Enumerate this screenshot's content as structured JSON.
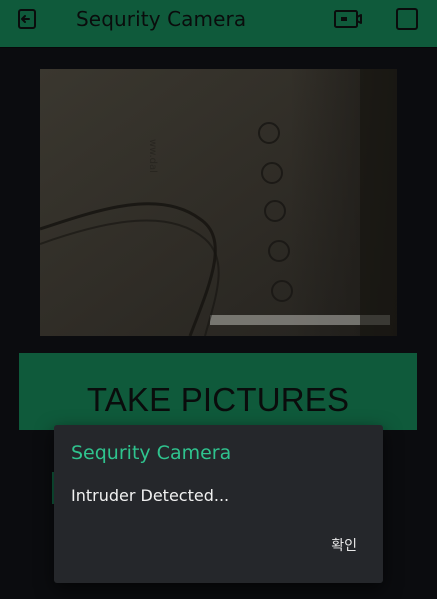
{
  "app_bar": {
    "title": "Sequrity Camera",
    "color": "#0f5a3b",
    "icons": {
      "left": "exit-icon",
      "right_primary": "camera-switch-icon",
      "right_secondary": "stop-icon"
    }
  },
  "preview": {
    "icon": "camera-preview-image"
  },
  "actions": {
    "take_pictures_label": "TAKE PICTURES"
  },
  "dialog": {
    "title": "Sequrity Camera",
    "message": "Intruder Detected...",
    "ok_label": "확인",
    "title_color": "#2fc38e"
  }
}
